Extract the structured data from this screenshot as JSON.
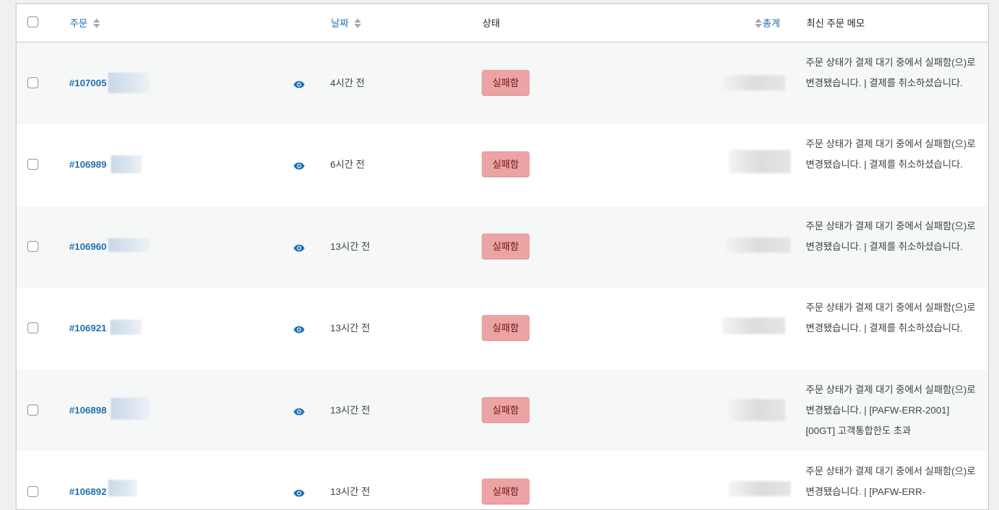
{
  "header": {
    "order": "주문",
    "date": "날짜",
    "status": "상태",
    "total": "총계",
    "memo": "최신 주문 메모"
  },
  "icons": {
    "sort": "sort-arrows-icon",
    "preview": "eye-icon",
    "checkbox": "checkbox-icon"
  },
  "colors": {
    "link": "#2271b1",
    "failed_badge_bg": "#eba3a3",
    "failed_badge_text": "#761919",
    "row_alt": "#f6f7f7"
  },
  "rows": [
    {
      "order": "#107005",
      "date": "4시간 전",
      "status": "실패함",
      "memo": "주문 상태가 결제 대기 중에서 실패함(으)로 변경됐습니다. | 결제를 취소하셨습니다."
    },
    {
      "order": "#106989",
      "date": "6시간 전",
      "status": "실패함",
      "memo": "주문 상태가 결제 대기 중에서 실패함(으)로 변경됐습니다. | 결제를 취소하셨습니다."
    },
    {
      "order": "#106960",
      "date": "13시간 전",
      "status": "실패함",
      "memo": "주문 상태가 결제 대기 중에서 실패함(으)로 변경됐습니다. | 결제를 취소하셨습니다."
    },
    {
      "order": "#106921",
      "date": "13시간 전",
      "status": "실패함",
      "memo": "주문 상태가 결제 대기 중에서 실패함(으)로 변경됐습니다. | 결제를 취소하셨습니다."
    },
    {
      "order": "#106898",
      "date": "13시간 전",
      "status": "실패함",
      "memo": "주문 상태가 결제 대기 중에서 실패함(으)로 변경됐습니다. | [PAFW-ERR-2001] [00GT] 고객통합한도 초과"
    },
    {
      "order": "#106892",
      "date": "13시간 전",
      "status": "실패함",
      "memo": "주문 상태가 결제 대기 중에서 실패함(으)로 변경됐습니다. | [PAFW-ERR-"
    }
  ]
}
